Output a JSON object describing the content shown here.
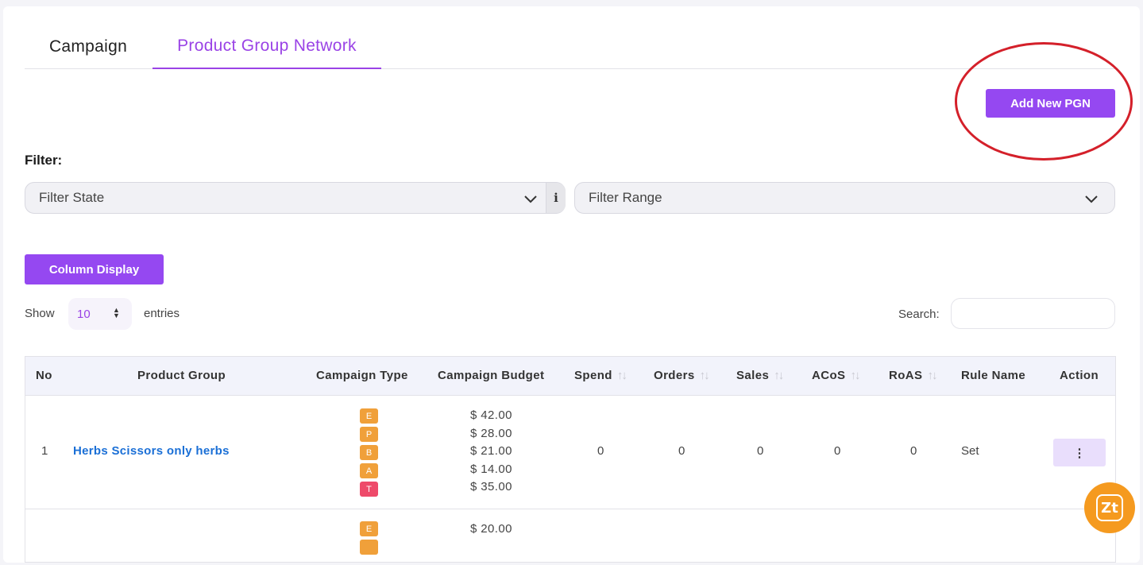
{
  "tabs": [
    {
      "label": "Campaign"
    },
    {
      "label": "Product Group Network"
    }
  ],
  "add_button": {
    "label": "Add New PGN"
  },
  "filter": {
    "label": "Filter:",
    "state_placeholder": "Filter State",
    "range_placeholder": "Filter Range",
    "info_glyph": "i"
  },
  "column_display": {
    "label": "Column Display"
  },
  "entries": {
    "show": "Show",
    "value": "10",
    "suffix": "entries"
  },
  "search": {
    "label": "Search:",
    "value": ""
  },
  "table": {
    "headers": {
      "no": "No",
      "product_group": "Product Group",
      "campaign_type": "Campaign Type",
      "campaign_budget": "Campaign Budget",
      "spend": "Spend",
      "orders": "Orders",
      "sales": "Sales",
      "acos": "ACoS",
      "roas": "RoAS",
      "rule_name": "Rule Name",
      "action": "Action"
    },
    "sort_glyph": "↑↓",
    "rows": [
      {
        "no": "1",
        "product_group": "Herbs Scissors only herbs",
        "campaign_types": [
          {
            "letter": "E",
            "color": "#f0a03a"
          },
          {
            "letter": "P",
            "color": "#f0a03a"
          },
          {
            "letter": "B",
            "color": "#f0a03a"
          },
          {
            "letter": "A",
            "color": "#f0a03a"
          },
          {
            "letter": "T",
            "color": "#ee4a6a"
          }
        ],
        "budgets": [
          "$ 42.00",
          "$ 28.00",
          "$ 21.00",
          "$ 14.00",
          "$ 35.00"
        ],
        "spend": "0",
        "orders": "0",
        "sales": "0",
        "acos": "0",
        "roas": "0",
        "rule_name": "Set",
        "action": "⋮"
      },
      {
        "campaign_types": [
          {
            "letter": "E",
            "color": "#f0a03a"
          }
        ],
        "budgets": [
          "$ 20.00"
        ]
      }
    ]
  },
  "chat_widget": {
    "label": "Zt"
  },
  "colors": {
    "accent": "#9548f1",
    "annotation": "#d4202a",
    "link": "#1a6fd6",
    "widget": "#f59a1f"
  }
}
